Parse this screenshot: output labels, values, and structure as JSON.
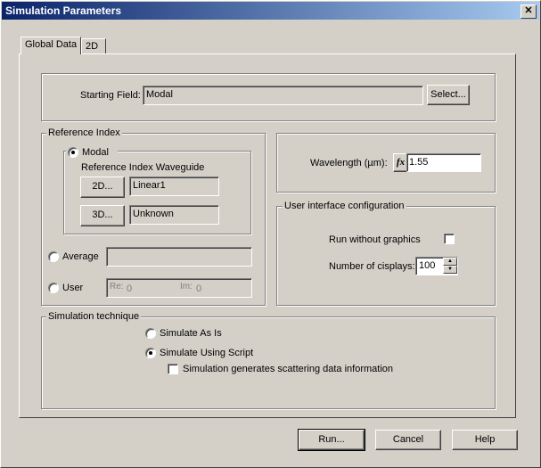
{
  "window": {
    "title": "Simulation Parameters",
    "close_glyph": "✕"
  },
  "tabs": [
    {
      "label": "Global Data"
    },
    {
      "label": "2D"
    }
  ],
  "starting_field": {
    "label": "Starting Field:",
    "value": "Modal",
    "select_label": "Select..."
  },
  "reference_index": {
    "legend": "Reference Index",
    "modal_label": "Modal",
    "waveguide_label": "Reference Index Waveguide",
    "btn_2d": "2D...",
    "value_2d": "Linear1",
    "btn_3d": "3D...",
    "value_3d": "Unknown",
    "average_label": "Average",
    "average_value": "",
    "user_label": "User",
    "re_label": "Re:",
    "re_value": "0",
    "im_label": "Im:",
    "im_value": "0"
  },
  "wavelength": {
    "label": "Wavelength (µm):",
    "fx": "fx",
    "value": "1.55"
  },
  "ui_config": {
    "legend": "User interface configuration",
    "run_without_graphics": "Run without graphics",
    "num_displays_label": "Number of cisplays:",
    "num_displays_value": "100"
  },
  "simulation": {
    "legend": "Simulation technique",
    "as_is": "Simulate As Is",
    "using_script": "Simulate Using Script",
    "scattering": "Simulation generates scattering data information"
  },
  "buttons": {
    "run": "Run...",
    "cancel": "Cancel",
    "help": "Help"
  }
}
